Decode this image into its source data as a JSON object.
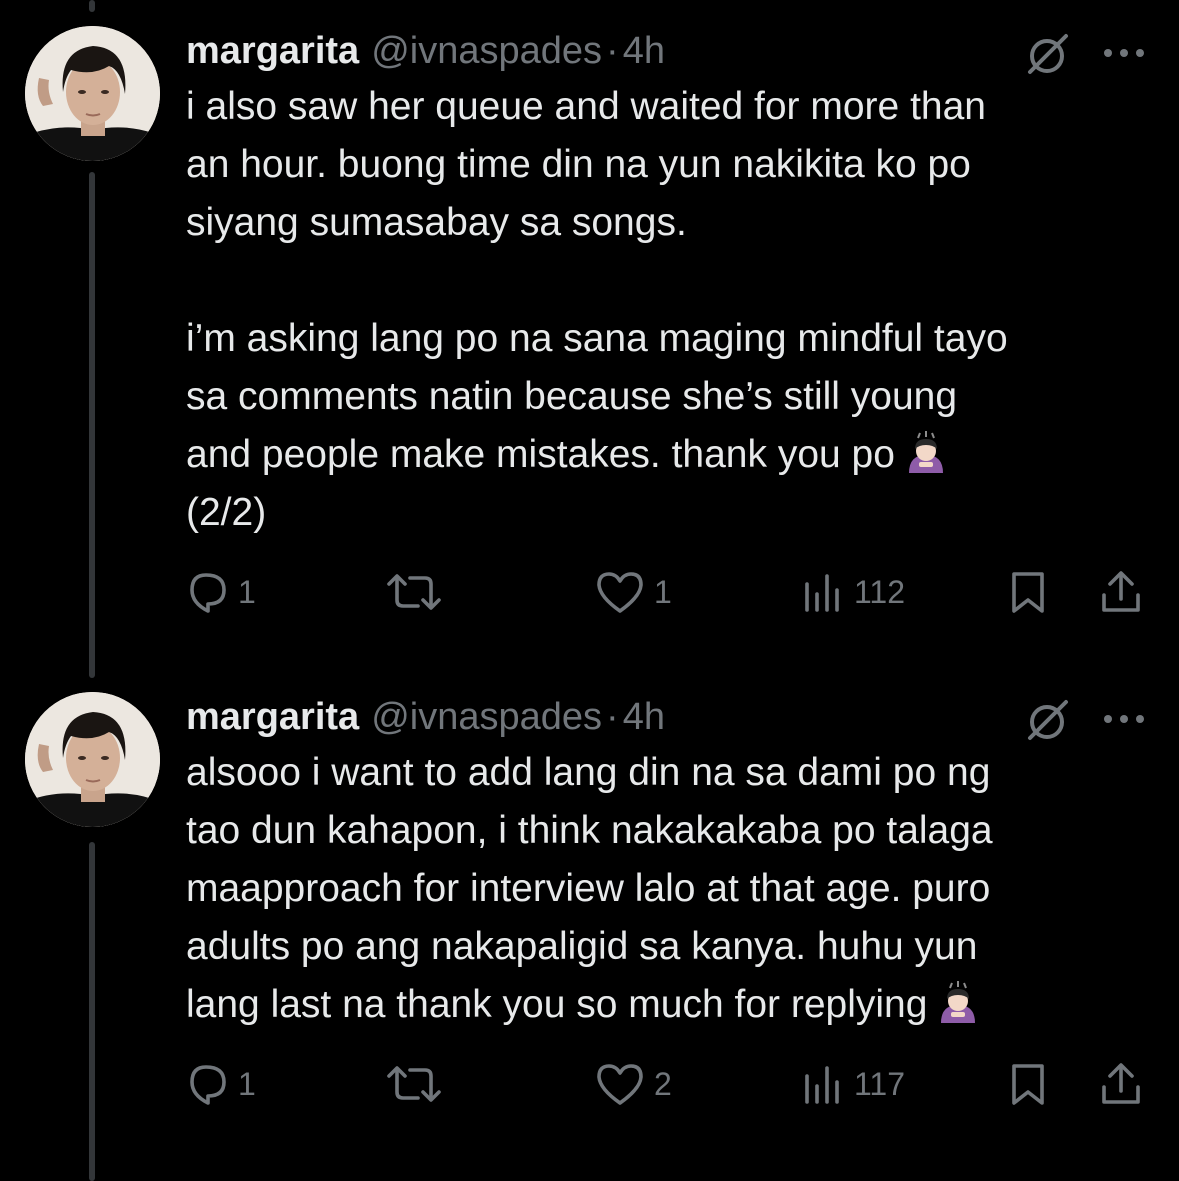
{
  "colors": {
    "background": "#000000",
    "text": "#e7e9ea",
    "muted": "#71767b",
    "thread_line": "#333639"
  },
  "tweets": [
    {
      "author": {
        "name": "margarita",
        "handle": "@ivnaspades",
        "separator": "·",
        "time": "4h",
        "avatar_icon": "avatar-photo"
      },
      "text": "i also saw her queue and waited for more than\nan hour. buong time din na yun nakikita ko po\nsiyang sumasabay sa songs.\n\ni’m asking lang po na sana maging mindful tayo\nsa comments natin because she’s still young\nand people make mistakes. thank you po",
      "text_suffix": "(2/2)",
      "emoji_icon": "person-bowing-emoji",
      "actions": {
        "reply_icon": "reply-icon",
        "reply_count": "1",
        "retweet_icon": "retweet-icon",
        "retweet_count": "",
        "like_icon": "heart-icon",
        "like_count": "1",
        "views_icon": "views-icon",
        "views_count": "112",
        "bookmark_icon": "bookmark-icon",
        "share_icon": "share-icon"
      }
    },
    {
      "author": {
        "name": "margarita",
        "handle": "@ivnaspades",
        "separator": "·",
        "time": "4h",
        "avatar_icon": "avatar-photo"
      },
      "text": "alsooo i want to add lang din na sa dami po ng\ntao dun kahapon, i think nakakakaba po talaga\nmaapproach for interview lalo at that age. puro\nadults po ang nakapaligid sa kanya. huhu yun\nlang last na thank you so much for replying",
      "text_suffix": "",
      "emoji_icon": "person-bowing-emoji",
      "actions": {
        "reply_icon": "reply-icon",
        "reply_count": "1",
        "retweet_icon": "retweet-icon",
        "retweet_count": "",
        "like_icon": "heart-icon",
        "like_count": "2",
        "views_icon": "views-icon",
        "views_count": "117",
        "bookmark_icon": "bookmark-icon",
        "share_icon": "share-icon"
      }
    }
  ]
}
